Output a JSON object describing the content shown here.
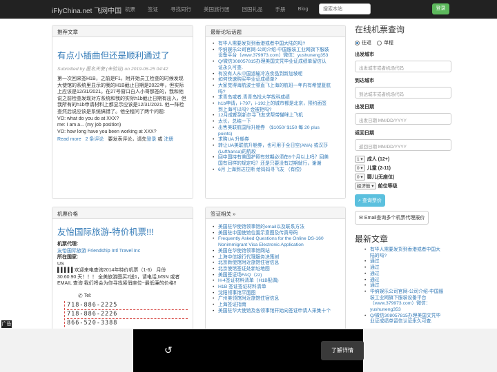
{
  "navbar": {
    "brand": "iFlyChina.net 飞网中国",
    "links": [
      "机票",
      "签证",
      "寻找同行",
      "美国旅行团",
      "回国礼品",
      "手册",
      "Blog",
      "论坛"
    ],
    "search_placeholder": "搜索本站",
    "login_label": "登录"
  },
  "recommended": {
    "heading": "推荐文章",
    "title": "有点小插曲但还是顺利通过了",
    "meta": "Submitted by 匿名天使 (未验证) on 2019-06-25 04:42",
    "body_lines": [
      "第一次回来签H1B，之前是F1，附开始员工检查的时候发现",
      "大使馆的系统里显示的我的H1B截止日期是2022年，但实际",
      "上应该是12/31/2021。在27号窗口白人小哥那签的，我和他",
      "说之前检查发现对方系统和我的实际h1b截止日期有出入，但",
      "我所有的h1b申请材料上都显示应该是12/31/2021. 他一阵检",
      "查然后说应该是系统搞错了。他全程问了两个问题:",
      "VO: what do you do at XXX?",
      "me: I am a... (my job position)",
      "VO: how long have you been working at XXX?"
    ],
    "read_more": "Read more",
    "comments": "2 条评论",
    "reply_text": "要发表评论，请先",
    "login": "登录",
    "or": "或",
    "register": "注册"
  },
  "prices": {
    "heading": "机票价格",
    "title": "友怡国际旅游-特价机票!!!",
    "agent_label": "机票代理:",
    "agent_name": "友怡国际旅游 Friendship Intl Travel Inc",
    "country_label": "所在国家:",
    "country": "US",
    "desc_lines": [
      "▌▌▌▌▌欢迎来电查询2014年特价机票（1-6） 月份",
      "30.60.90 天！！！ 全美旅游图买2送1，请电话,MSN 或者",
      "EMAIL 查询 我们将会为你寻找紧俏座位~最低廉的价格!!"
    ],
    "tel_label": "Tel:",
    "phones": [
      "718-886-2225",
      "718-886-2226",
      "866-520-3388"
    ]
  },
  "forum": {
    "heading": "最新论坛话题",
    "items": [
      "有华人需要发货到香港或者中国大陆的吗?",
      "华纳娱乐公司官网-公司介绍-中国服装工业网旗下服装",
      "设备平台（www.379973.com）微信：yushuneng353",
      "Q/微信308057815办理美国文凭毕业证成绩单留信认",
      "证永久可查.",
      "有没有人从中国运输冷冻食品到新加坡呢",
      "如何快速购买毕业证成绩单?",
      "大家觉得海航波士顿直飞上海的航班一年内有希望复航",
      "吗?",
      "求青岛或者,青青岛找大学找科成绩",
      "h1b申请，i-797，i-192上的城市都是北京，预约面签",
      "到上海可以吗? 会被拒吗?",
      "12月成都到新尔寻飞友求帮带猫咪上飞机",
      "太长，总结一下",
      "出售美联航国际升舱券 （$1050/ $150 每 20 plus",
      "points)",
      "求购UA 升舱券",
      "转让UA美联航升舱券，也可用于全日空(ANA) 或汉莎",
      "(Lufthansa)的航段",
      "回中国持有美国护照有效期必须在6个月以上吗？回美",
      "国有同样的规定吗？还是只要没有过期就行，谢谢",
      "6月 上海到达拉斯 给妈妈寻飞友 （有偿）"
    ]
  },
  "visa": {
    "heading": "签证相关 »",
    "items": [
      "美国驻华使馆领事馆的email以及联系方法",
      "美国驻中国使馆位置示意图及传真号码",
      "Frequently Asked Questions for the Online DS-160",
      "Nonimmigrant Visa Electronic Application",
      "美国在华使馆领事馆网站",
      "上海中信银行代理服务决策树",
      "北京新使馆附近旅馆住宿信息",
      "北京使馆签证处新址地图",
      "美国签证场FAQ（zz)",
      "H-4签证材料清单（H1B配偶)",
      "H1B 签证签证材料清单",
      "沈阳领事馆平面图",
      "广州美领馆附近旅馆住宿信息",
      "上海签证指南",
      "美国驻华大使馆及各领事馆开始向签证申请人采集十个"
    ]
  },
  "booking": {
    "heading": "在线机票查询",
    "trip_roundtrip": "往返",
    "trip_oneway": "单程",
    "from_label": "出发城市",
    "from_placeholder": "出发城市或者机场代码",
    "to_label": "到达城市",
    "to_placeholder": "到达城市或者机场代码",
    "depart_label": "出发日期",
    "depart_placeholder": "出发日期 MM/DD/YYYY",
    "return_label": "返回日期",
    "return_placeholder": "返回日期 MM/DD/YYYY",
    "adults_value": "1",
    "adults_label": "成人 (12+)",
    "children_value": "0",
    "children_label": "儿童 (2-11)",
    "infants_value": "0",
    "infants_label": "婴儿(无座位)",
    "cabin_value": "经济舱",
    "cabin_label": "舱位等级",
    "search_label": "查询票价",
    "email_label": "Email查询多个机票代理报价"
  },
  "latest": {
    "heading": "最新文章",
    "items": [
      "有华人需要发货到香港或者中国大",
      "陆的吗?",
      "通过",
      "通过",
      "通过",
      "通过",
      "通过",
      "华纳娱乐公司官网-公司介绍-中国服",
      "装工业网旗下服装设备平台",
      "（www.379973.com）微信：",
      "yushuneng353",
      "Q/微信308057815办理美国文凭毕",
      "业证成绩单留信认证永久可查."
    ]
  },
  "ad": {
    "label": "广告",
    "replay": "↺",
    "button": "了解详情"
  }
}
